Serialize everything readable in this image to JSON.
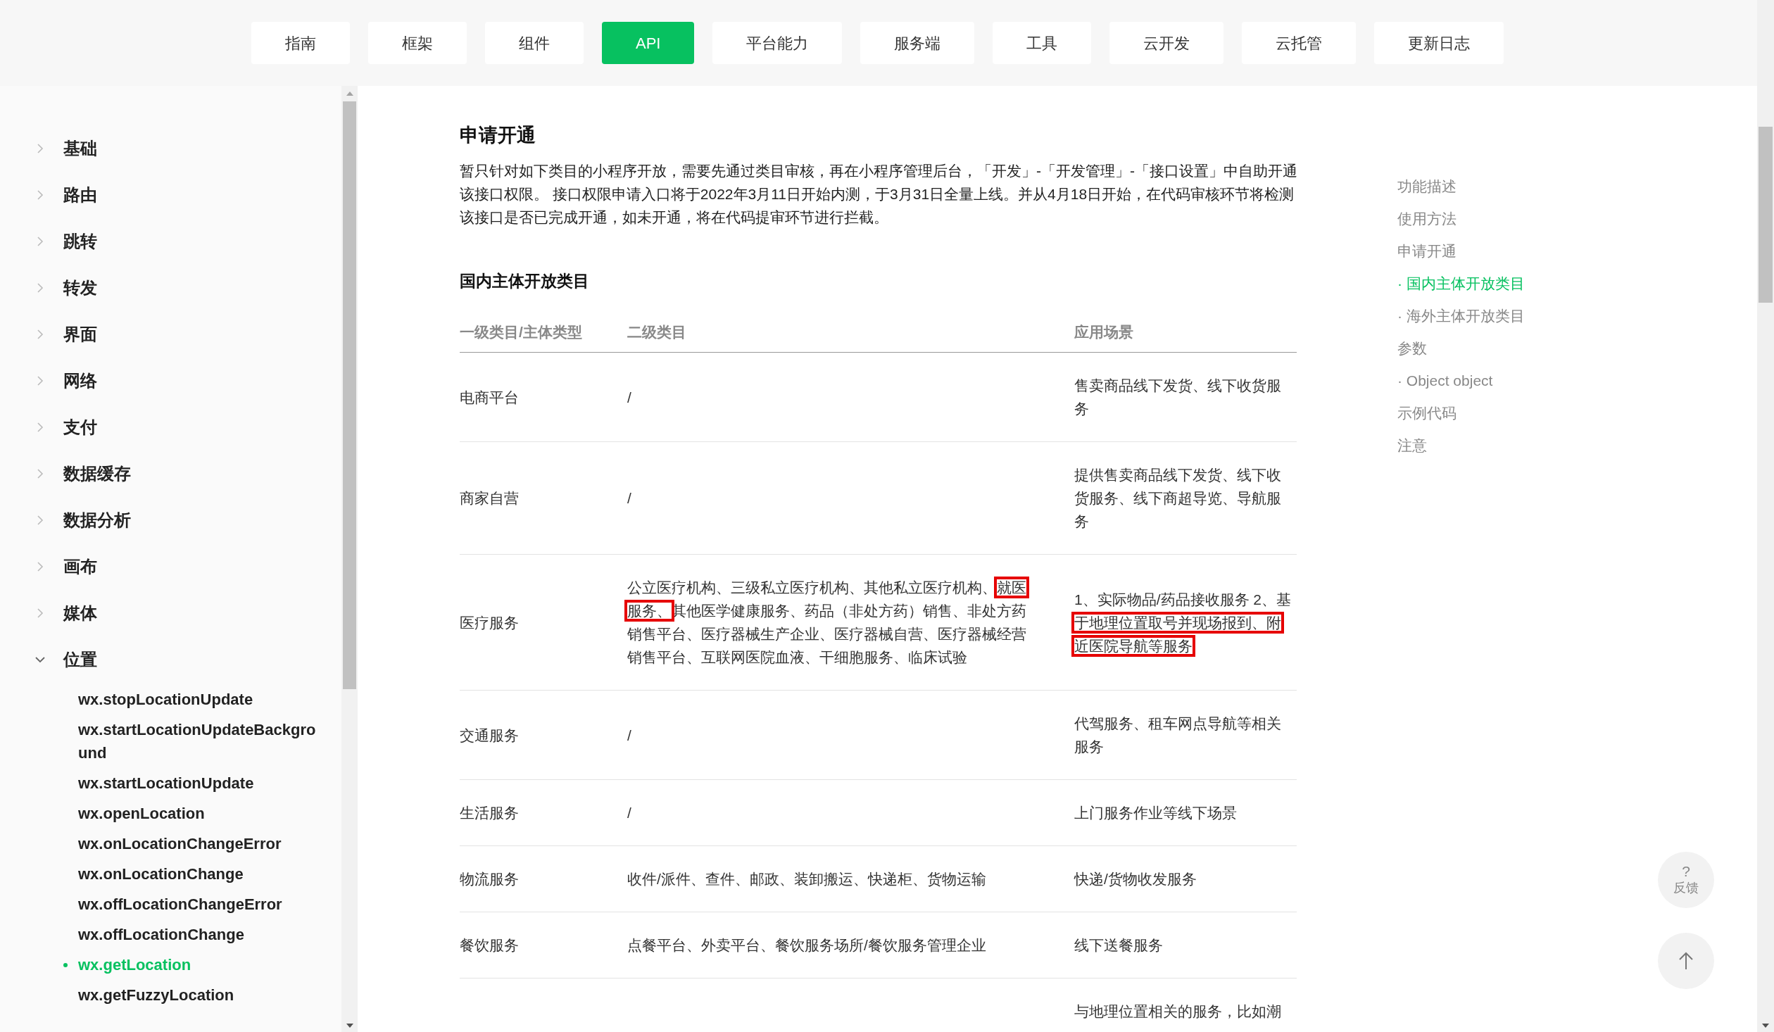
{
  "nav": [
    {
      "label": "指南",
      "selected": false
    },
    {
      "label": "框架",
      "selected": false
    },
    {
      "label": "组件",
      "selected": false
    },
    {
      "label": "API",
      "selected": true
    },
    {
      "label": "平台能力",
      "selected": false
    },
    {
      "label": "服务端",
      "selected": false
    },
    {
      "label": "工具",
      "selected": false
    },
    {
      "label": "云开发",
      "selected": false
    },
    {
      "label": "云托管",
      "selected": false
    },
    {
      "label": "更新日志",
      "selected": false
    }
  ],
  "sidebar": {
    "items": [
      {
        "label": "基础",
        "expanded": false
      },
      {
        "label": "路由",
        "expanded": false
      },
      {
        "label": "跳转",
        "expanded": false
      },
      {
        "label": "转发",
        "expanded": false
      },
      {
        "label": "界面",
        "expanded": false
      },
      {
        "label": "网络",
        "expanded": false
      },
      {
        "label": "支付",
        "expanded": false
      },
      {
        "label": "数据缓存",
        "expanded": false
      },
      {
        "label": "数据分析",
        "expanded": false
      },
      {
        "label": "画布",
        "expanded": false
      },
      {
        "label": "媒体",
        "expanded": false
      },
      {
        "label": "位置",
        "expanded": true,
        "children": [
          {
            "label": "wx.stopLocationUpdate",
            "selected": false
          },
          {
            "label": "wx.startLocationUpdateBackground",
            "selected": false
          },
          {
            "label": "wx.startLocationUpdate",
            "selected": false
          },
          {
            "label": "wx.openLocation",
            "selected": false
          },
          {
            "label": "wx.onLocationChangeError",
            "selected": false
          },
          {
            "label": "wx.onLocationChange",
            "selected": false
          },
          {
            "label": "wx.offLocationChangeError",
            "selected": false
          },
          {
            "label": "wx.offLocationChange",
            "selected": false
          },
          {
            "label": "wx.getLocation",
            "selected": true
          },
          {
            "label": "wx.getFuzzyLocation",
            "selected": false
          }
        ]
      }
    ]
  },
  "content": {
    "heading": "申请开通",
    "paragraph": "暂只针对如下类目的小程序开放，需要先通过类目审核，再在小程序管理后台，「开发」-「开发管理」-「接口设置」中自助开通该接口权限。 接口权限申请入口将于2022年3月11日开始内测，于3月31日全量上线。并从4月18日开始，在代码审核环节将检测该接口是否已完成开通，如未开通，将在代码提审环节进行拦截。",
    "subheading": "国内主体开放类目",
    "table": {
      "columns": [
        "一级类目/主体类型",
        "二级类目",
        "应用场景"
      ],
      "rows": [
        {
          "cells": [
            "电商平台",
            "/",
            "售卖商品线下发货、线下收货服务"
          ]
        },
        {
          "cells": [
            "商家自营",
            "/",
            "提供售卖商品线下发货、线下收货服务、线下商超导览、导航服务"
          ]
        },
        {
          "cells": [
            "医疗服务",
            {
              "segments": [
                {
                  "text": "公立医疗机构、三级私立医疗机构、其他私立医疗机构、",
                  "highlighted": false
                },
                {
                  "text": "就医服务、",
                  "highlighted": true
                },
                {
                  "text": "其他医学健康服务、药品（非处方药）销售、非处方药销售平台、医疗器械生产企业、医疗器械自营、医疗器械经营销售平台、互联网医院血液、干细胞服务、临床试验",
                  "highlighted": false
                }
              ]
            },
            {
              "segments": [
                {
                  "text": "1、实际物品/药品接收服务 2、基",
                  "highlighted": false
                },
                {
                  "text": "于地理位置取号并现场报到、附近医院导航等服务",
                  "highlighted": true
                }
              ]
            }
          ]
        },
        {
          "cells": [
            "交通服务",
            "/",
            "代驾服务、租车网点导航等相关服务"
          ]
        },
        {
          "cells": [
            "生活服务",
            "/",
            "上门服务作业等线下场景"
          ]
        },
        {
          "cells": [
            "物流服务",
            "收件/派件、查件、邮政、装卸搬运、快递柜、货物运输",
            "快递/货物收发服务"
          ]
        },
        {
          "cells": [
            "餐饮服务",
            "点餐平台、外卖平台、餐饮服务场所/餐饮服务管理企业",
            "线下送餐服务"
          ]
        },
        {
          "cells": [
            "",
            "",
            "与地理位置相关的服务，比如潮"
          ]
        }
      ]
    }
  },
  "toc": [
    {
      "label": "功能描述",
      "selected": false
    },
    {
      "label": "使用方法",
      "selected": false
    },
    {
      "label": "申请开通",
      "selected": false,
      "children": [
        {
          "label": "· 国内主体开放类目",
          "selected": true
        },
        {
          "label": "· 海外主体开放类目",
          "selected": false
        }
      ]
    },
    {
      "label": "参数",
      "selected": false,
      "children": [
        {
          "label": "· Object object",
          "selected": false
        }
      ]
    },
    {
      "label": "示例代码",
      "selected": false
    },
    {
      "label": "注意",
      "selected": false
    }
  ],
  "feedback": {
    "icon_text": "?",
    "label": "反馈"
  }
}
